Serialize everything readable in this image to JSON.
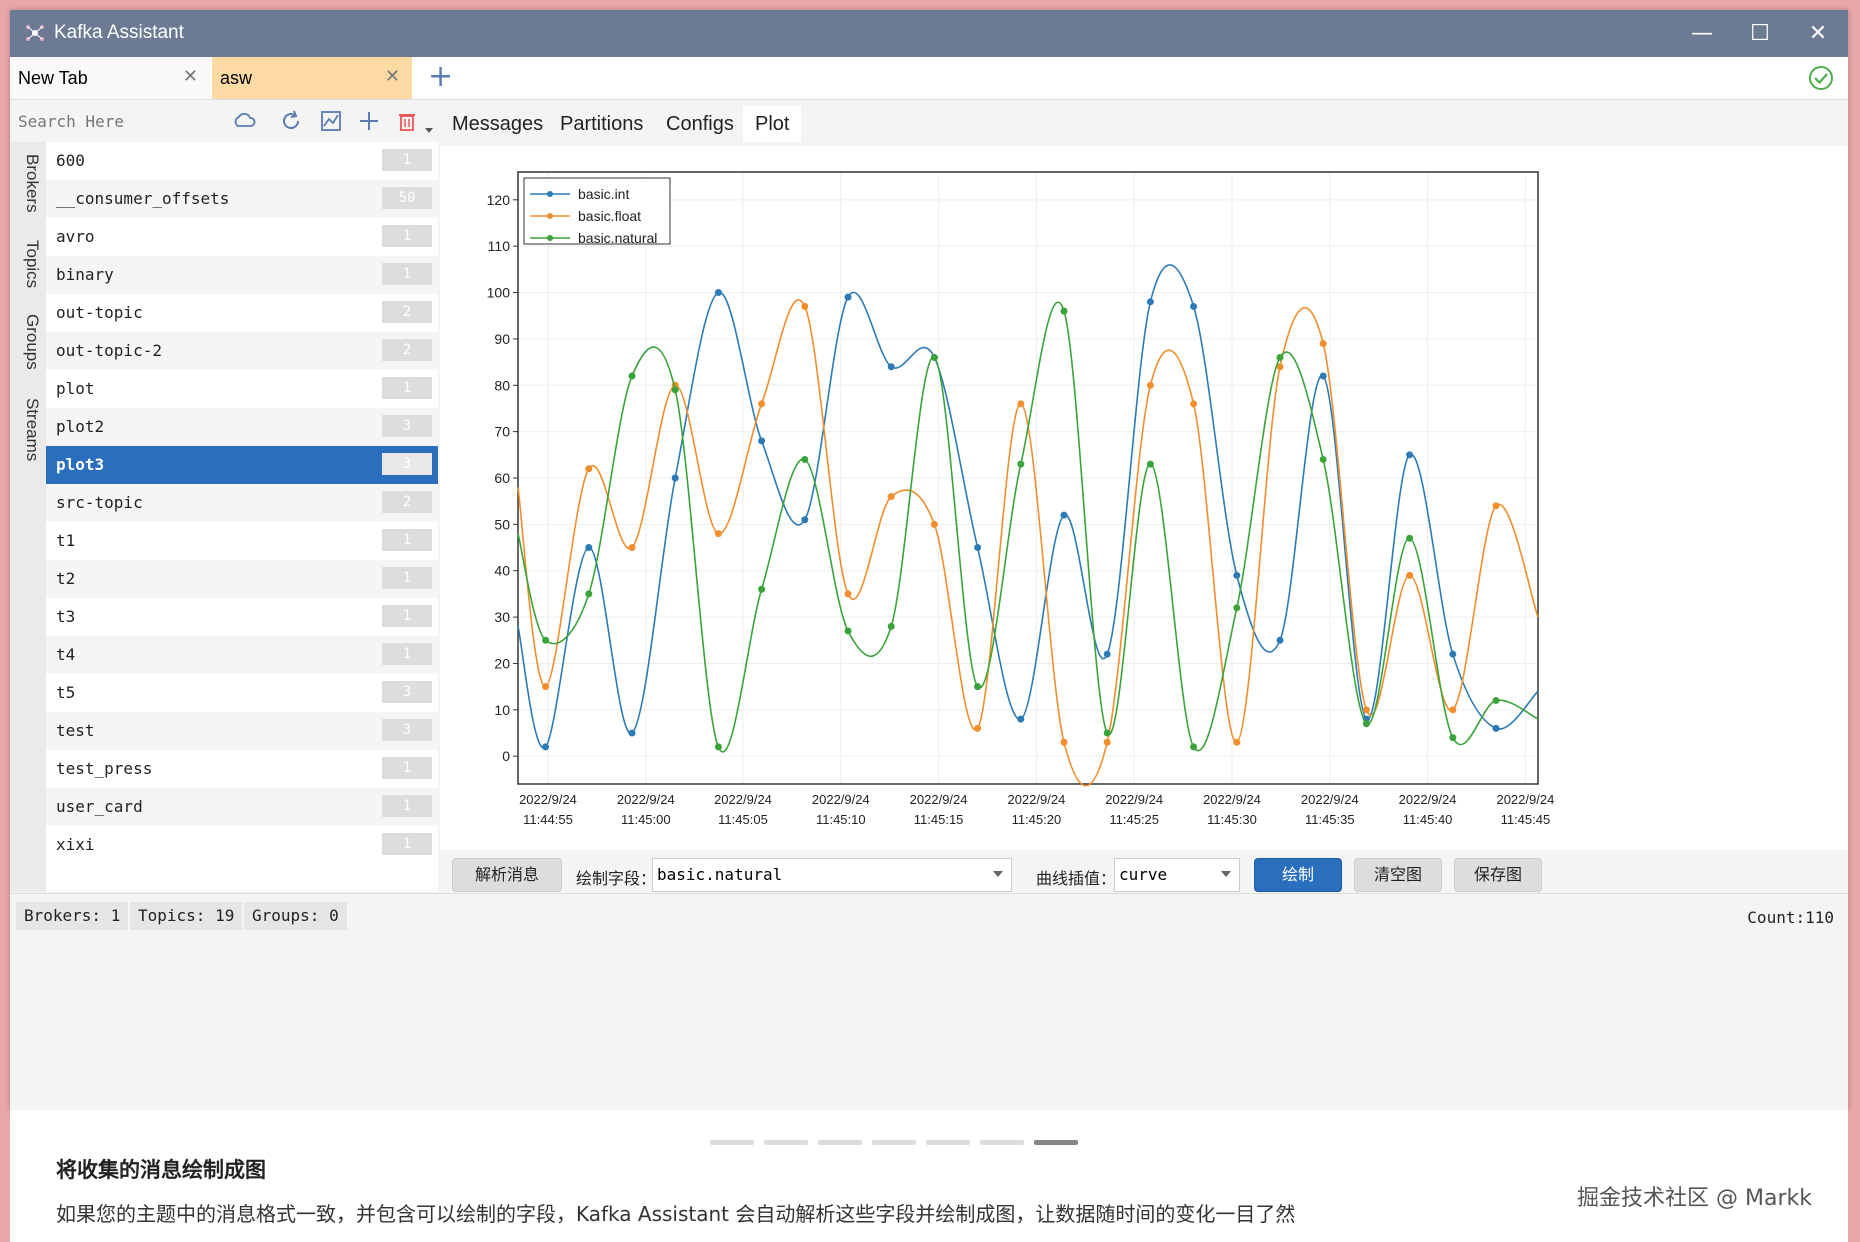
{
  "app": {
    "title": "Kafka Assistant"
  },
  "tabs": [
    {
      "label": "New Tab"
    },
    {
      "label": "asw"
    }
  ],
  "search": {
    "placeholder": "Search Here"
  },
  "side_tabs": [
    "Brokers",
    "Topics",
    "Groups",
    "Streams"
  ],
  "topics": [
    {
      "name": "600",
      "partitions": "1"
    },
    {
      "name": "__consumer_offsets",
      "partitions": "50"
    },
    {
      "name": "avro",
      "partitions": "1"
    },
    {
      "name": "binary",
      "partitions": "1"
    },
    {
      "name": "out-topic",
      "partitions": "2"
    },
    {
      "name": "out-topic-2",
      "partitions": "2"
    },
    {
      "name": "plot",
      "partitions": "1"
    },
    {
      "name": "plot2",
      "partitions": "3"
    },
    {
      "name": "plot3",
      "partitions": "3",
      "selected": true
    },
    {
      "name": "src-topic",
      "partitions": "2"
    },
    {
      "name": "t1",
      "partitions": "1"
    },
    {
      "name": "t2",
      "partitions": "1"
    },
    {
      "name": "t3",
      "partitions": "1"
    },
    {
      "name": "t4",
      "partitions": "1"
    },
    {
      "name": "t5",
      "partitions": "3"
    },
    {
      "name": "test",
      "partitions": "3"
    },
    {
      "name": "test_press",
      "partitions": "1"
    },
    {
      "name": "user_card",
      "partitions": "1"
    },
    {
      "name": "xixi",
      "partitions": "1"
    }
  ],
  "content_tabs": [
    "Messages",
    "Partitions",
    "Configs",
    "Plot"
  ],
  "plot_controls": {
    "parse_button": "解析消息",
    "field_label": "绘制字段：",
    "field_value": "basic.natural",
    "interp_label": "曲线插值：",
    "interp_value": "curve",
    "draw_button": "绘制",
    "clear_button": "清空图",
    "save_button": "保存图"
  },
  "status": {
    "brokers": "Brokers: 1",
    "topics": "Topics: 19",
    "groups": "Groups: 0",
    "count": "Count:110"
  },
  "caption": {
    "title": "将收集的消息绘制成图",
    "text": "如果您的主题中的消息格式一致，并包含可以绘制的字段，Kafka Assistant 会自动解析这些字段并绘制成图，让数据随时间的变化一目了然",
    "watermark": "掘金技术社区 @ Markk",
    "carousel_total": 7,
    "carousel_active": 7
  },
  "colors": {
    "titlebar": "#6c7b93",
    "selected": "#2a6ebe",
    "int": "#2c7bb6",
    "float": "#f28e2b",
    "natural": "#3aa43a"
  },
  "chart_data": {
    "type": "line",
    "ylim": [
      -6,
      126
    ],
    "yticks": [
      0,
      10,
      20,
      30,
      40,
      50,
      60,
      70,
      80,
      90,
      100,
      110,
      120
    ],
    "xlim": [
      0,
      170
    ],
    "xticks": [
      {
        "t": 5,
        "l1": "2022/9/24",
        "l2": "11:44:55"
      },
      {
        "t": 21.3,
        "l1": "2022/9/24",
        "l2": "11:45:00"
      },
      {
        "t": 37.5,
        "l1": "2022/9/24",
        "l2": "11:45:05"
      },
      {
        "t": 53.8,
        "l1": "2022/9/24",
        "l2": "11:45:10"
      },
      {
        "t": 70.1,
        "l1": "2022/9/24",
        "l2": "11:45:15"
      },
      {
        "t": 86.4,
        "l1": "2022/9/24",
        "l2": "11:45:20"
      },
      {
        "t": 102.7,
        "l1": "2022/9/24",
        "l2": "11:45:25"
      },
      {
        "t": 119,
        "l1": "2022/9/24",
        "l2": "11:45:30"
      },
      {
        "t": 135.3,
        "l1": "2022/9/24",
        "l2": "11:45:35"
      },
      {
        "t": 151.6,
        "l1": "2022/9/24",
        "l2": "11:45:40"
      },
      {
        "t": 167.9,
        "l1": "2022/9/24",
        "l2": "11:45:45"
      }
    ],
    "legend": "top-left",
    "grid": true,
    "series": [
      {
        "name": "basic.int",
        "color": "#2c7bb6",
        "points": [
          [
            0,
            28
          ],
          [
            4.6,
            2
          ],
          [
            11.8,
            45
          ],
          [
            19,
            5
          ],
          [
            26.2,
            60
          ],
          [
            33.4,
            100
          ],
          [
            40.6,
            68
          ],
          [
            47.8,
            51
          ],
          [
            55,
            99
          ],
          [
            62.2,
            84
          ],
          [
            69.4,
            86
          ],
          [
            76.6,
            45
          ],
          [
            83.8,
            8
          ],
          [
            91,
            52
          ],
          [
            98.2,
            22
          ],
          [
            105.4,
            98
          ],
          [
            112.6,
            97
          ],
          [
            119.8,
            39
          ],
          [
            127,
            25
          ],
          [
            134.2,
            82
          ],
          [
            141.4,
            8
          ],
          [
            148.6,
            65
          ],
          [
            155.8,
            22
          ],
          [
            163,
            6
          ],
          [
            170,
            14
          ]
        ]
      },
      {
        "name": "basic.float",
        "color": "#f28e2b",
        "points": [
          [
            0,
            58
          ],
          [
            4.6,
            15
          ],
          [
            11.8,
            62
          ],
          [
            19,
            45
          ],
          [
            26.2,
            80
          ],
          [
            33.4,
            48
          ],
          [
            40.6,
            76
          ],
          [
            47.8,
            97
          ],
          [
            55,
            35
          ],
          [
            62.2,
            56
          ],
          [
            69.4,
            50
          ],
          [
            76.6,
            6
          ],
          [
            83.8,
            76
          ],
          [
            91,
            3
          ],
          [
            98.2,
            3
          ],
          [
            105.4,
            80
          ],
          [
            112.6,
            76
          ],
          [
            119.8,
            3
          ],
          [
            127,
            84
          ],
          [
            134.2,
            89
          ],
          [
            141.4,
            10
          ],
          [
            148.6,
            39
          ],
          [
            155.8,
            10
          ],
          [
            163,
            54
          ],
          [
            170,
            30
          ]
        ]
      },
      {
        "name": "basic.natural",
        "color": "#3aa43a",
        "points": [
          [
            0,
            48
          ],
          [
            4.6,
            25
          ],
          [
            11.8,
            35
          ],
          [
            19,
            82
          ],
          [
            26.2,
            79
          ],
          [
            33.4,
            2
          ],
          [
            40.6,
            36
          ],
          [
            47.8,
            64
          ],
          [
            55,
            27
          ],
          [
            62.2,
            28
          ],
          [
            69.4,
            86
          ],
          [
            76.6,
            15
          ],
          [
            83.8,
            63
          ],
          [
            91,
            96
          ],
          [
            98.2,
            5
          ],
          [
            105.4,
            63
          ],
          [
            112.6,
            2
          ],
          [
            119.8,
            32
          ],
          [
            127,
            86
          ],
          [
            134.2,
            64
          ],
          [
            141.4,
            7
          ],
          [
            148.6,
            47
          ],
          [
            155.8,
            4
          ],
          [
            163,
            12
          ],
          [
            170,
            8
          ]
        ]
      }
    ]
  }
}
